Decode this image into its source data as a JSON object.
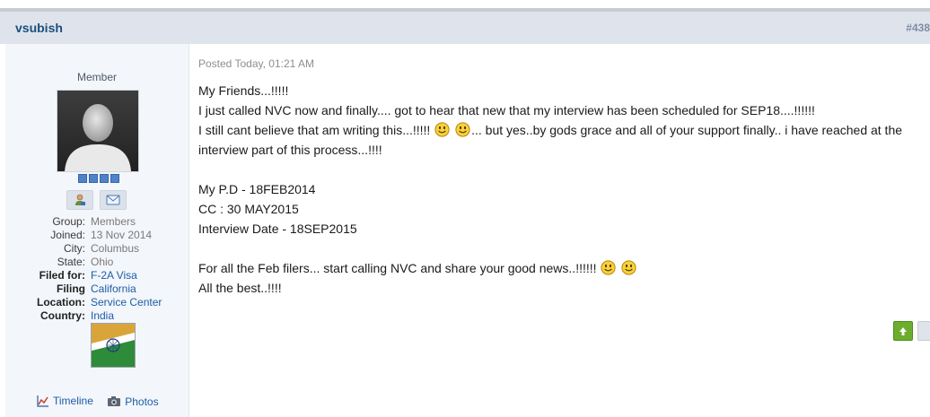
{
  "post": {
    "author": "vsubish",
    "number": "#438",
    "posted": "Posted Today, 01:21 AM",
    "lines": [
      {
        "segments": [
          "My Friends...!!!!!"
        ]
      },
      {
        "segments": [
          "I just called NVC now and finally.... got to hear that new that my interview has been scheduled for SEP18....!!!!!!"
        ]
      },
      {
        "segments": [
          "I still cant believe that am writing this...!!!!! ",
          " ",
          "... but yes..by gods grace and all of your support finally.. i have reached at the"
        ],
        "smileys_after": [
          0,
          1
        ]
      },
      {
        "segments": [
          "interview part of this process...!!!!"
        ]
      },
      {
        "segments": [
          ""
        ]
      },
      {
        "segments": [
          "My P.D - 18FEB2014"
        ]
      },
      {
        "segments": [
          "CC : 30 MAY2015"
        ]
      },
      {
        "segments": [
          "Interview Date - 18SEP2015"
        ]
      },
      {
        "segments": [
          ""
        ]
      },
      {
        "segments": [
          "For all the Feb filers... start calling NVC and share your good news..!!!!!! "
        ],
        "smileys_after": [
          0,
          0
        ]
      },
      {
        "segments": [
          "All the best..!!!!"
        ]
      }
    ]
  },
  "profile": {
    "rank": "Member",
    "pip_count": 4,
    "fields": [
      {
        "label": "Group:",
        "value": "Members",
        "bold": false,
        "link": false
      },
      {
        "label": "Joined:",
        "value": "13 Nov 2014",
        "bold": false,
        "link": false
      },
      {
        "label": "City:",
        "value": "Columbus",
        "bold": false,
        "link": false
      },
      {
        "label": "State:",
        "value": "Ohio",
        "bold": false,
        "link": false
      },
      {
        "label": "Filed for:",
        "value": "F-2A Visa",
        "bold": true,
        "link": true
      },
      {
        "label": "Filing",
        "value": "California",
        "bold": true,
        "link": true
      },
      {
        "label": "Location:",
        "value": "Service Center",
        "bold": true,
        "link": true
      },
      {
        "label": "Country:",
        "value": "India",
        "bold": true,
        "link": true
      }
    ],
    "links": {
      "timeline": "Timeline",
      "photos": "Photos"
    },
    "icons": {
      "profile": "user-profile-icon",
      "message": "message-icon",
      "timeline": "timeline-icon",
      "photos": "camera-icon",
      "reputation": "thumbs-up-icon"
    }
  },
  "colors": {
    "accent": "#1c4f7c",
    "link": "#1d5da6",
    "header_bg": "#dfe4ec",
    "sidebar_bg": "#f3f6fa",
    "rep_green": "#6cad2d"
  }
}
